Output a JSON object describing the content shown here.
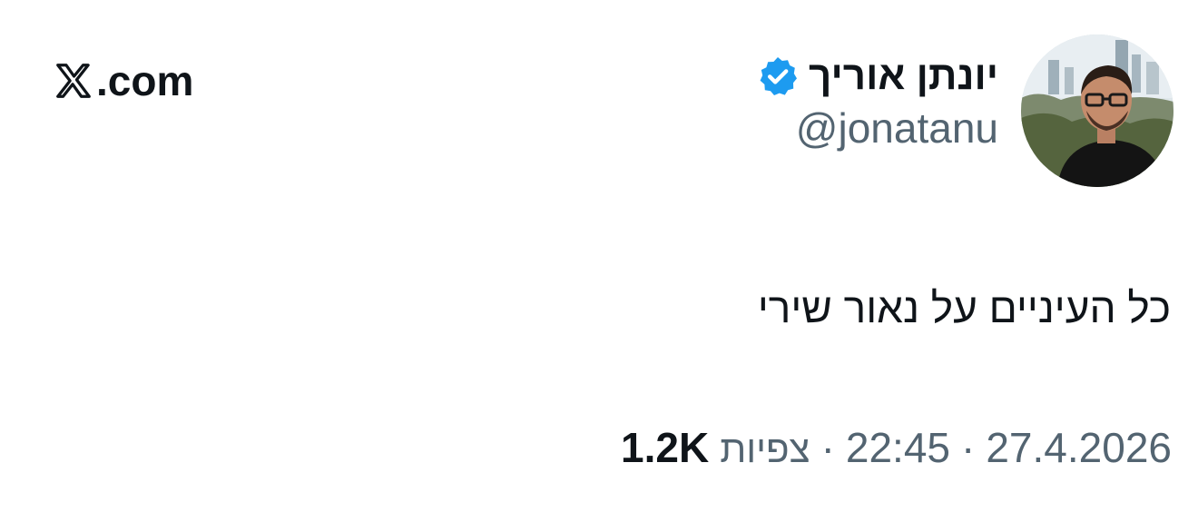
{
  "brand": {
    "text": ".com",
    "icon": "x-logo-icon"
  },
  "author": {
    "display_name": "יונתן אוריך",
    "handle": "@jonatanu",
    "verified_icon": "verified-badge-icon",
    "avatar_icon": "avatar-photo"
  },
  "tweet": {
    "text": "כל העיניים על נאור שירי"
  },
  "meta": {
    "date": "27.4.2026",
    "separator": "·",
    "time": "22:45",
    "views_label": "צפיות",
    "views_count": "1.2K"
  },
  "colors": {
    "text_primary": "#0f1419",
    "text_secondary": "#536471",
    "verified_blue": "#1d9bf0",
    "background": "#ffffff"
  }
}
